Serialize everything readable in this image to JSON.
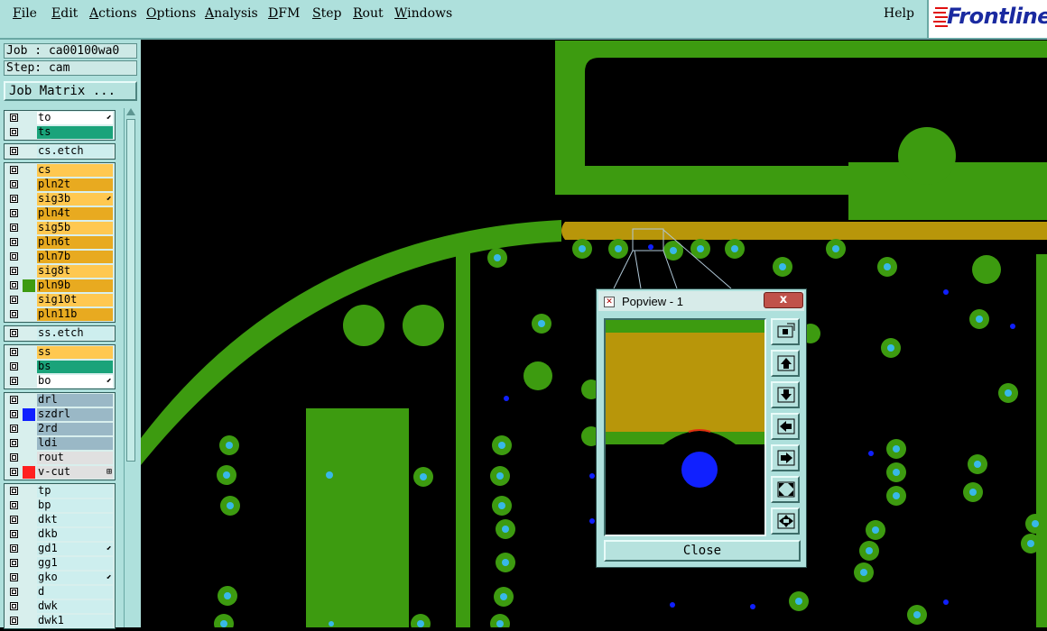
{
  "menu": {
    "items": [
      "File",
      "Edit",
      "Actions",
      "Options",
      "Analysis",
      "DFM",
      "Step",
      "Rout",
      "Windows"
    ],
    "help": "Help"
  },
  "logo": {
    "text": "Frontline"
  },
  "job": {
    "job_label": "Job : ca00100wa0",
    "step_label": "Step: cam",
    "matrix_button": "Job Matrix ..."
  },
  "layers": [
    {
      "name": "to",
      "color": "#ffffff",
      "mark": "⬋",
      "swatch": ""
    },
    {
      "name": "ts",
      "color": "#1aa37a",
      "mark": "",
      "swatch": ""
    },
    {
      "name": "cs.etch",
      "color": "#cdeeee",
      "mark": "",
      "swatch": ""
    },
    {
      "name": "cs",
      "color": "#ffc850",
      "mark": "",
      "swatch": ""
    },
    {
      "name": "pln2t",
      "color": "#e8aa20",
      "mark": "",
      "swatch": ""
    },
    {
      "name": "sig3b",
      "color": "#ffc850",
      "mark": "⬋",
      "swatch": ""
    },
    {
      "name": "pln4t",
      "color": "#e8aa20",
      "mark": "",
      "swatch": ""
    },
    {
      "name": "sig5b",
      "color": "#ffc850",
      "mark": "",
      "swatch": ""
    },
    {
      "name": "pln6t",
      "color": "#e8aa20",
      "mark": "",
      "swatch": ""
    },
    {
      "name": "pln7b",
      "color": "#e8aa20",
      "mark": "",
      "swatch": ""
    },
    {
      "name": "sig8t",
      "color": "#ffc850",
      "mark": "",
      "swatch": ""
    },
    {
      "name": "pln9b",
      "color": "#e8aa20",
      "mark": "",
      "swatch": "#3d9b10"
    },
    {
      "name": "sig10t",
      "color": "#ffc850",
      "mark": "",
      "swatch": ""
    },
    {
      "name": "pln11b",
      "color": "#e8aa20",
      "mark": "",
      "swatch": ""
    },
    {
      "name": "ss.etch",
      "color": "#cdeeee",
      "mark": "",
      "swatch": ""
    },
    {
      "name": "ss",
      "color": "#ffc850",
      "mark": "",
      "swatch": ""
    },
    {
      "name": "bs",
      "color": "#1aa37a",
      "mark": "",
      "swatch": ""
    },
    {
      "name": "bo",
      "color": "#ffffff",
      "mark": "⬋",
      "swatch": ""
    },
    {
      "name": "drl",
      "color": "#9ab8c6",
      "mark": "",
      "swatch": ""
    },
    {
      "name": "szdrl",
      "color": "#9ab8c6",
      "mark": "",
      "swatch": "#1020ff"
    },
    {
      "name": "2rd",
      "color": "#9ab8c6",
      "mark": "",
      "swatch": ""
    },
    {
      "name": "ldi",
      "color": "#9ab8c6",
      "mark": "",
      "swatch": ""
    },
    {
      "name": "rout",
      "color": "#e0e0e0",
      "mark": "",
      "swatch": ""
    },
    {
      "name": "v-cut",
      "color": "#e0e0e0",
      "mark": "⊞",
      "swatch": "#ff2020"
    },
    {
      "name": "tp",
      "color": "#cdeeee",
      "mark": "",
      "swatch": ""
    },
    {
      "name": "bp",
      "color": "#cdeeee",
      "mark": "",
      "swatch": ""
    },
    {
      "name": "dkt",
      "color": "#cdeeee",
      "mark": "",
      "swatch": ""
    },
    {
      "name": "dkb",
      "color": "#cdeeee",
      "mark": "",
      "swatch": ""
    },
    {
      "name": "gd1",
      "color": "#cdeeee",
      "mark": "⬋",
      "swatch": ""
    },
    {
      "name": "gg1",
      "color": "#cdeeee",
      "mark": "",
      "swatch": ""
    },
    {
      "name": "gko",
      "color": "#cdeeee",
      "mark": "⬋",
      "swatch": ""
    },
    {
      "name": "d",
      "color": "#cdeeee",
      "mark": "",
      "swatch": ""
    },
    {
      "name": "dwk",
      "color": "#cdeeee",
      "mark": "",
      "swatch": ""
    },
    {
      "name": "dwk1",
      "color": "#cdeeee",
      "mark": "",
      "swatch": ""
    }
  ],
  "popview": {
    "title": "Popview - 1",
    "close_x": "x",
    "close_button": "Close"
  },
  "colors": {
    "board": "#3d9b10",
    "trace_gold": "#b8960a",
    "pad_cyan": "#38b8e8",
    "via_blue": "#1020ff",
    "ui_bg": "#aee0dc"
  }
}
